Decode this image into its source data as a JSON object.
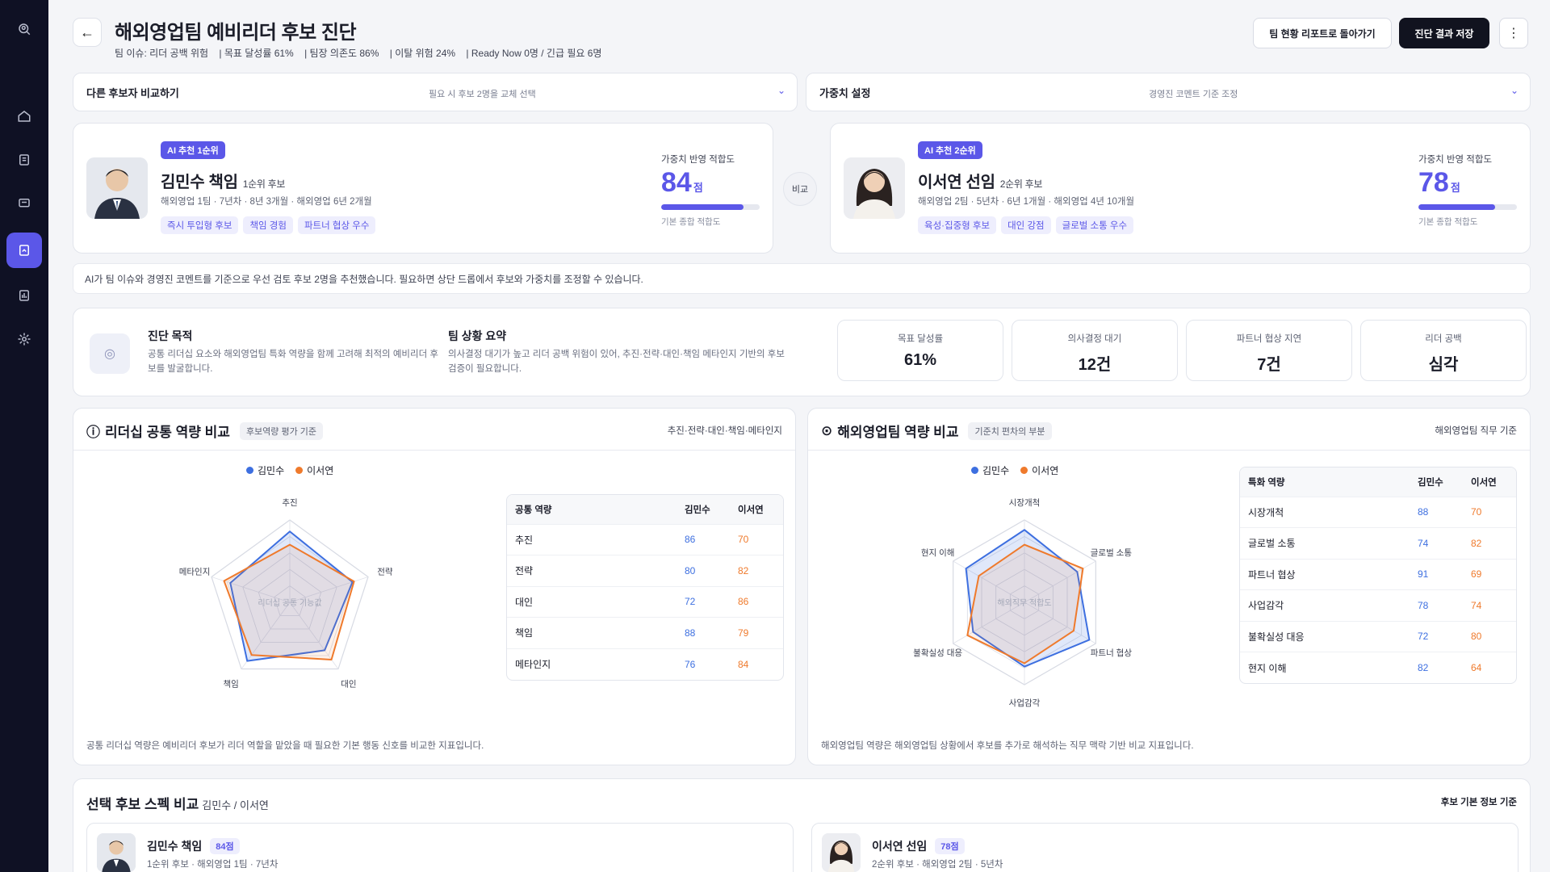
{
  "header": {
    "title": "해외영업팀 예비리더 후보 진단",
    "sub": [
      "팀 이슈: 리더 공백 위험",
      "| 목표 달성률 61%",
      "| 팀장 의존도 86%",
      "| 이탈 위험 24%",
      "| Ready Now 0명 / 긴급 필요 6명"
    ],
    "back_label": "←",
    "btn_report": "팀 현황 리포트로 돌아가기",
    "btn_save": "진단 결과 저장",
    "btn_more": "⋮"
  },
  "dropdowns": {
    "compare": {
      "label": "다른 후보자 비교하기",
      "hint": "필요 시 후보 2명을 교체 선택",
      "chev": "⌄"
    },
    "weight": {
      "label": "가중치 설정",
      "hint": "경영진 코멘트 기준 조정",
      "chev": "⌄"
    }
  },
  "candidates": [
    {
      "badge": "AI 추천 1순위",
      "name": "김민수 책임",
      "rank": "1순위 후보",
      "info": "해외영업 1팀 · 7년차 · 8년 3개월 · 해외영업 6년 2개월",
      "tags": [
        "즉시 투입형 후보",
        "책임 경험",
        "파트너 협상 우수"
      ],
      "fit_label": "가중치 반영 적합도",
      "fit_score": "84",
      "fit_unit": "점",
      "fit_value": 84,
      "fit_note": "기본 종합 적합도"
    },
    {
      "badge": "AI 추천 2순위",
      "name": "이서연 선임",
      "rank": "2순위 후보",
      "info": "해외영업 2팀 · 5년차 · 6년 1개월 · 해외영업 4년 10개월",
      "tags": [
        "육성·집중형 후보",
        "대인 강점",
        "글로벌 소통 우수"
      ],
      "fit_label": "가중치 반영 적합도",
      "fit_score": "78",
      "fit_unit": "점",
      "fit_value": 78,
      "fit_note": "기본 종합 적합도"
    }
  ],
  "vs_label": "비교",
  "ai_note": "AI가 팀 이슈와 경영진 코멘트를 기준으로 우선 검토 후보 2명을 추천했습니다. 필요하면 상단 드롭에서 후보와 가중치를 조정할 수 있습니다.",
  "summary": {
    "icon_glyph": "◎",
    "purpose_title": "진단 목적",
    "purpose_text": "공통 리더십 요소와 해외영업팀 특화 역량을 함께 고려해 최적의 예비리더 후보를 발굴합니다.",
    "team_title": "팀 상황 요약",
    "team_text": "의사결정 대기가 높고 리더 공백 위험이 있어, 추진·전략·대인·책임 메타인지 기반의 후보 검증이 필요합니다.",
    "kpis": [
      {
        "label": "목표 달성률",
        "value": "61%"
      },
      {
        "label": "의사결정 대기",
        "value": "12건"
      },
      {
        "label": "파트너 협상 지연",
        "value": "7건"
      },
      {
        "label": "리더 공백",
        "value": "심각"
      }
    ]
  },
  "panels": [
    {
      "icon_glyph": "ⓘ",
      "title": "리더십 공통 역량 비교",
      "badge": "후보역량 평가 기준",
      "right": "추진·전략·대인·책임·메타인지",
      "legend": [
        "김민수",
        "이서연"
      ],
      "center_label": "리더십 공통 기능값",
      "table_headers": [
        "공통 역량",
        "김민수",
        "이서연"
      ],
      "foot": "공통 리더십 역량은 예비리더 후보가 리더 역할을 맡았을 때 필요한 기본 행동 신호를 비교한 지표입니다."
    },
    {
      "icon_glyph": "⊙",
      "title": "해외영업팀 역량 비교",
      "badge": "기준치 편차의 부분",
      "right": "해외영업팀 직무 기준",
      "legend": [
        "김민수",
        "이서연"
      ],
      "center_label": "해외직무 적합도",
      "table_headers": [
        "특화 역량",
        "김민수",
        "이서연"
      ],
      "foot": "해외영업팀 역량은 해외영업팀 상황에서 후보를 추가로 해석하는 직무 맥락 기반 비교 지표입니다."
    }
  ],
  "chart_data": [
    {
      "type": "radar",
      "axes": [
        "추진",
        "전략",
        "대인",
        "책임",
        "메타인지"
      ],
      "series": [
        {
          "name": "김민수",
          "values": [
            86,
            80,
            72,
            88,
            76
          ]
        },
        {
          "name": "이서연",
          "values": [
            70,
            82,
            86,
            79,
            84
          ]
        }
      ],
      "range": [
        0,
        100
      ]
    },
    {
      "type": "radar",
      "axes": [
        "시장개척",
        "글로벌 소통",
        "파트너 협상",
        "사업감각",
        "불확실성 대응",
        "현지 이해"
      ],
      "series": [
        {
          "name": "김민수",
          "values": [
            88,
            74,
            91,
            78,
            72,
            82
          ]
        },
        {
          "name": "이서연",
          "values": [
            70,
            82,
            69,
            74,
            80,
            64
          ]
        }
      ],
      "range": [
        0,
        100
      ]
    }
  ],
  "colors": {
    "series1": "#3d6fe0",
    "series2": "#ef7a2c",
    "accent": "#5b57e8"
  },
  "spec": {
    "title": "선택 후보 스펙 비교",
    "title_sub": "김민수 / 이서연",
    "right": "후보 기본 정보 기준",
    "cards": [
      {
        "name": "김민수 책임",
        "score": "84점",
        "info": "1순위 후보 · 해외영업 1팀 · 7년차"
      },
      {
        "name": "이서연 선임",
        "score": "78점",
        "info": "2순위 후보 · 해외영업 2팀 · 5년차"
      }
    ]
  },
  "rail": [
    "search-icon",
    "home-icon",
    "document-icon",
    "chat-icon",
    "report-icon",
    "chart-icon",
    "gear-icon"
  ]
}
